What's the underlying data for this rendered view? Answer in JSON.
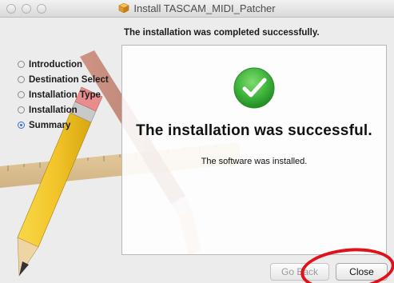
{
  "window": {
    "title": "Install TASCAM_MIDI_Patcher"
  },
  "header": {
    "status_heading": "The installation was completed successfully."
  },
  "sidebar": {
    "steps": [
      {
        "label": "Introduction",
        "current": false
      },
      {
        "label": "Destination Select",
        "current": false
      },
      {
        "label": "Installation Type",
        "current": false
      },
      {
        "label": "Installation",
        "current": false
      },
      {
        "label": "Summary",
        "current": true
      }
    ]
  },
  "main": {
    "success_title": "The installation was successful.",
    "success_message": "The software was installed."
  },
  "buttons": {
    "go_back_label": "Go Back",
    "close_label": "Close"
  },
  "colors": {
    "check_green": "#3fb43d",
    "highlight_ring": "#e1111b",
    "current_step_blue": "#2f6fd6"
  }
}
